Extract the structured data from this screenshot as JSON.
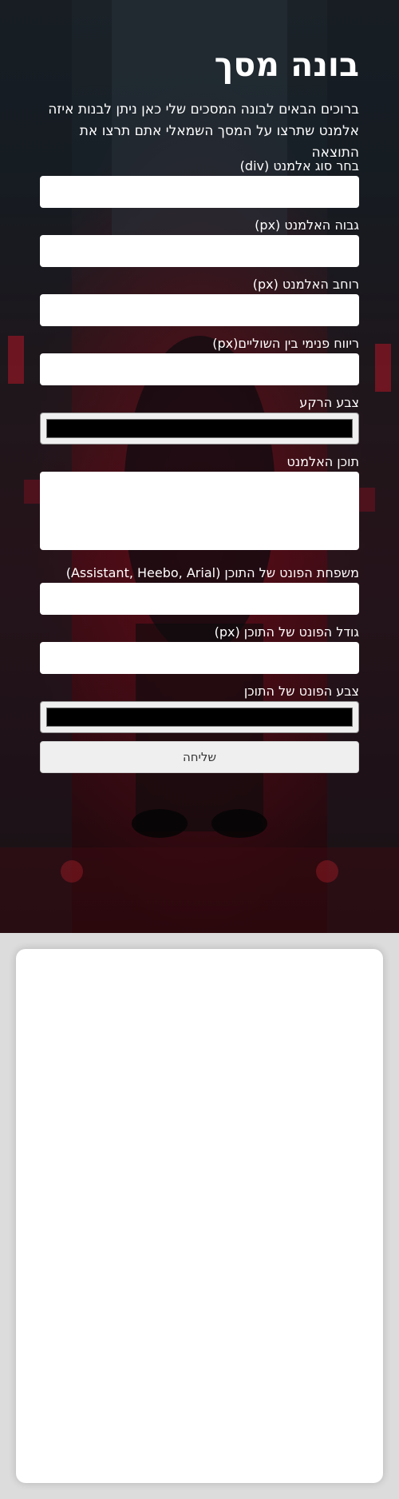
{
  "header": {
    "title": "בונה מסך",
    "intro": "ברוכים הבאים לבונה המסכים שלי כאן ניתן לבנות איזה אלמנט שתרצו על המסך השמאלי אתם תרצו את התוצאה"
  },
  "form": {
    "element_type": {
      "label": "בחר סוג אלמנט (div)",
      "value": ""
    },
    "element_height": {
      "label": "גבוה האלמנט (px)",
      "value": ""
    },
    "element_width": {
      "label": "רוחב האלמנט (px)",
      "value": ""
    },
    "padding": {
      "label": "ריווח פנימי בין השוליים(px)",
      "value": ""
    },
    "background_color": {
      "label": "צבע הרקע",
      "value": "#000000"
    },
    "content": {
      "label": "תוכן האלמנט",
      "value": ""
    },
    "font_family": {
      "label": "משפחת הפונט של התוכן (Assistant, Heebo, Arial)",
      "value": ""
    },
    "font_size": {
      "label": "גודל הפונט של התוכן (px)",
      "value": ""
    },
    "font_color": {
      "label": "צבע הפונט של התוכן",
      "value": "#000000"
    },
    "submit_label": "שליחה"
  },
  "colors": {
    "hero_background": "#2a0a10",
    "accent_red": "#8b0f1e",
    "input_background": "#ffffff",
    "button_background": "#efefef",
    "page_background": "#dcdcdc"
  },
  "preview": {}
}
